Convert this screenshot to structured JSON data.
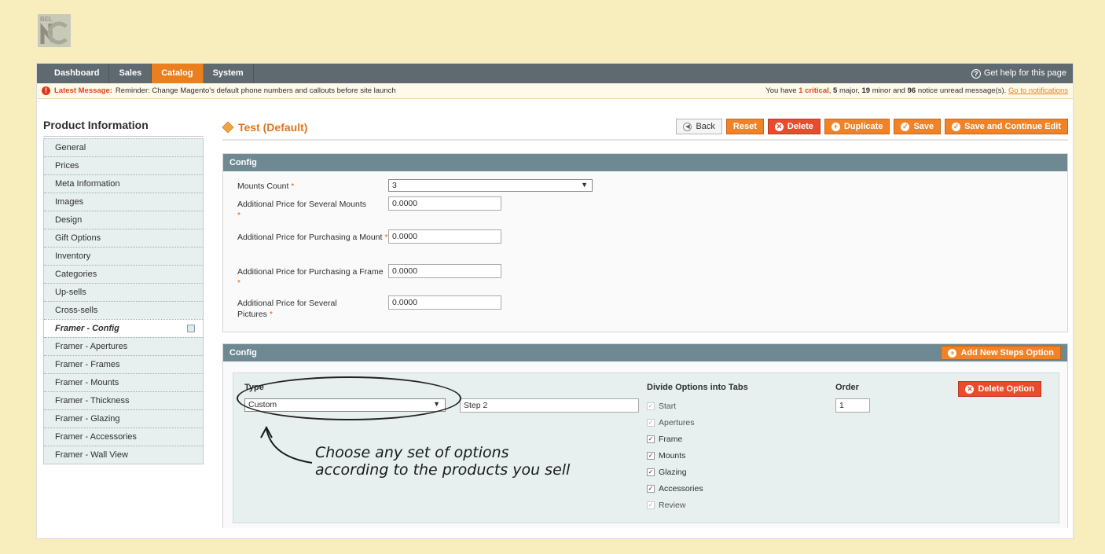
{
  "logo": {
    "text": "BEL"
  },
  "nav": {
    "items": [
      "Dashboard",
      "Sales",
      "Catalog",
      "System"
    ],
    "active": "Catalog",
    "help": "Get help for this page"
  },
  "notice": {
    "label": "Latest Message:",
    "message": "Reminder: Change Magento's default phone numbers and callouts before site launch",
    "prefix": "You have",
    "critical": "1 critical",
    "major": "5",
    "major_text": "major,",
    "minor": "19",
    "minor_text": "minor and",
    "notice_count": "96",
    "notice_text": "notice unread message(s).",
    "link": "Go to notifications"
  },
  "sidebar": {
    "title": "Product Information",
    "items": [
      "General",
      "Prices",
      "Meta Information",
      "Images",
      "Design",
      "Gift Options",
      "Inventory",
      "Categories",
      "Up-sells",
      "Cross-sells",
      "Framer - Config",
      "Framer - Apertures",
      "Framer - Frames",
      "Framer - Mounts",
      "Framer - Thickness",
      "Framer - Glazing",
      "Framer - Accessories",
      "Framer - Wall View"
    ],
    "active": "Framer - Config"
  },
  "page": {
    "title": "Test (Default)",
    "buttons": {
      "back": "Back",
      "reset": "Reset",
      "delete": "Delete",
      "duplicate": "Duplicate",
      "save": "Save",
      "save_continue": "Save and Continue Edit"
    }
  },
  "config1": {
    "title": "Config",
    "fields": [
      {
        "label": "Mounts Count",
        "value": "3",
        "type": "select"
      },
      {
        "label": "Additional Price for Several Mounts",
        "value": "0.0000"
      },
      {
        "label": "Additional Price for Purchasing a Mount",
        "value": "0.0000"
      },
      {
        "label": "Additional Price for Purchasing a Frame",
        "value": "0.0000"
      },
      {
        "label": "Additional Price for Several Pictures",
        "value": "0.0000"
      }
    ],
    "required_mark": "*"
  },
  "config2": {
    "title": "Config",
    "add_button": "Add New Steps Option",
    "type_label": "Type",
    "type_value": "Custom",
    "step_value": "Step 2",
    "divide_label": "Divide Options into Tabs",
    "tabs": [
      {
        "label": "Start",
        "checked": true,
        "disabled": true
      },
      {
        "label": "Apertures",
        "checked": true,
        "disabled": true
      },
      {
        "label": "Frame",
        "checked": true,
        "disabled": false
      },
      {
        "label": "Mounts",
        "checked": true,
        "disabled": false
      },
      {
        "label": "Glazing",
        "checked": true,
        "disabled": false
      },
      {
        "label": "Accessories",
        "checked": true,
        "disabled": false
      },
      {
        "label": "Review",
        "checked": true,
        "disabled": true
      }
    ],
    "order_label": "Order",
    "order_value": "1",
    "delete_option": "Delete Option"
  },
  "annotation": {
    "line1": "Choose any set of options",
    "line2": "according to the products you sell"
  }
}
